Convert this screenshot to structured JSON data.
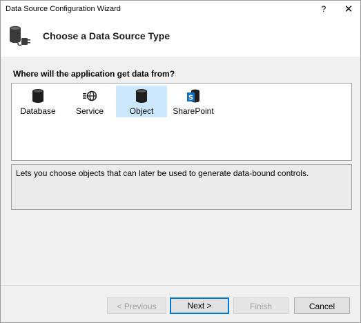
{
  "window": {
    "title": "Data Source Configuration Wizard",
    "help_glyph": "?",
    "close_glyph": "✕"
  },
  "header": {
    "title": "Choose a Data Source Type",
    "icon": "database-plug-icon"
  },
  "question": "Where will the application get data from?",
  "sources": [
    {
      "label": "Database",
      "icon": "database-icon",
      "selected": false
    },
    {
      "label": "Service",
      "icon": "service-globe-icon",
      "selected": false
    },
    {
      "label": "Object",
      "icon": "object-cylinder-icon",
      "selected": true
    },
    {
      "label": "SharePoint",
      "icon": "sharepoint-icon",
      "selected": false
    }
  ],
  "description": "Lets you choose objects that can later be used to generate data-bound controls.",
  "buttons": {
    "previous": {
      "label": "< Previous",
      "enabled": false
    },
    "next": {
      "label": "Next >",
      "enabled": true
    },
    "finish": {
      "label": "Finish",
      "enabled": false
    },
    "cancel": {
      "label": "Cancel",
      "enabled": true
    }
  },
  "colors": {
    "selection": "#cce8ff",
    "accent": "#0078d7",
    "sharepoint_blue": "#0a6fbf"
  }
}
